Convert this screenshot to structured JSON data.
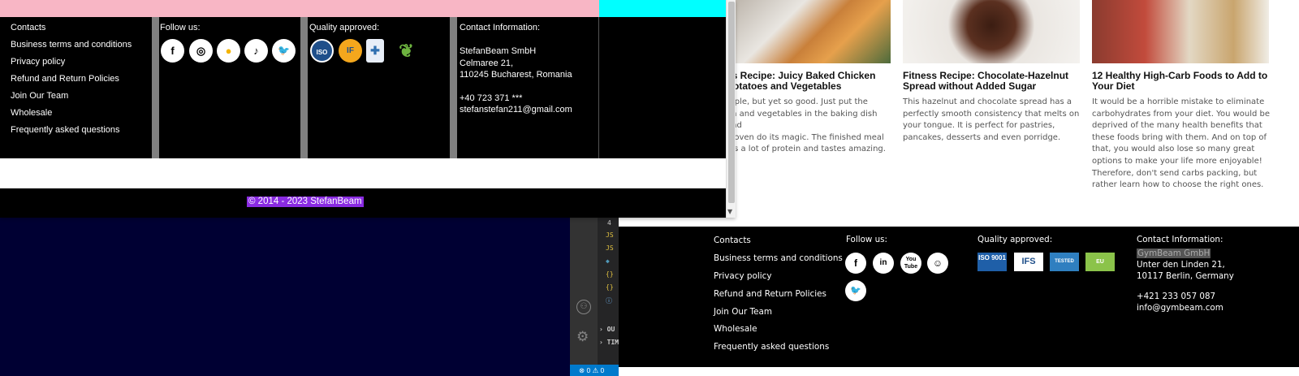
{
  "right_page": {
    "articles": [
      {
        "title_l1": "ss Recipe: Juicy Baked Chicken",
        "title_l2": " Potatoes and Vegetables",
        "lines": [
          "mple, but yet so good. Just put the",
          "en and vegetables in the baking dish and",
          "e oven do its magic. The finished meal",
          "ins a lot of protein and tastes amazing."
        ]
      },
      {
        "title_l1": "Fitness Recipe: Chocolate-Hazelnut",
        "title_l2": "Spread without Added Sugar",
        "lines": [
          "This hazelnut and chocolate spread has a",
          "perfectly smooth consistency that melts on",
          "your tongue. It is perfect for pastries,",
          "pancakes, desserts and even porridge."
        ]
      },
      {
        "title_l1": "12 Healthy High-Carb Foods to Add to",
        "title_l2": "Your Diet",
        "lines": [
          "It would be a horrible mistake to eliminate",
          "carbohydrates from your diet. You would be",
          "deprived of the many health benefits that",
          "these foods bring with them. And on top of",
          "that, you would also lose so many great",
          "options to make your life more enjoyable!",
          "Therefore, don't send carbs packing, but",
          "rather learn how to choose the right ones."
        ]
      }
    ],
    "footer": {
      "links": [
        "Contacts",
        "Business terms and conditions",
        "Privacy policy",
        "Refund and Return Policies",
        "Join Our Team",
        "Wholesale",
        "Frequently asked questions"
      ],
      "follow_heading": "Follow us:",
      "social": [
        "f",
        "in",
        "You Tube",
        "☺",
        "🐦"
      ],
      "social_icons": [
        "facebook-icon",
        "linkedin-icon",
        "youtube-icon",
        "snapchat-icon",
        "twitter-icon"
      ],
      "quality_heading": "Quality approved:",
      "badges": [
        "ISO 9001",
        "IFS",
        "TESTED",
        "EU"
      ],
      "contact_heading": "Contact Information:",
      "company": "GymBeam GmbH",
      "address_l1": "Unter den Linden 21,",
      "address_l2": "10117 Berlin, Germany",
      "phone": "+421 233 057 087",
      "email": "info@gymbeam.com"
    }
  },
  "left_window": {
    "links": [
      "Contacts",
      "Business terms and conditions",
      "Privacy policy",
      "Refund and Return Policies",
      "Join Our Team",
      "Wholesale",
      "Frequently asked questions"
    ],
    "follow_heading": "Follow us:",
    "social": [
      "f",
      "◎",
      "●",
      "♪",
      "🐦"
    ],
    "social_icons": [
      "facebook-icon",
      "instagram-icon",
      "youtube-icon",
      "tiktok-icon",
      "twitter-icon"
    ],
    "quality_heading": "Quality approved:",
    "badges": [
      "ISO",
      "IF",
      "✚",
      "❦"
    ],
    "contact_heading": "Contact Information:",
    "company": "StefanBeam SmbH",
    "address_l1": "Celmaree 21,",
    "address_l2": "110245 Bucharest, Romania",
    "phone": "+40 723 371 ***",
    "email": "stefanstefan211@gmail.com",
    "copyright": "© 2014 - 2023 StefanBeam"
  },
  "vscode": {
    "lines": [
      "4",
      "JS",
      "JS",
      "◆",
      "{}",
      "{}",
      "ⓘ"
    ],
    "sections": [
      "OU",
      "TIM"
    ],
    "status": "⊗ 0 ⚠ 0"
  },
  "colors": {
    "pink": "#f8b6c5",
    "cyan": "#00ffff",
    "purple_highlight": "#8a2be2",
    "vscode_blue": "#007acc",
    "dark_navy": "#000033"
  }
}
